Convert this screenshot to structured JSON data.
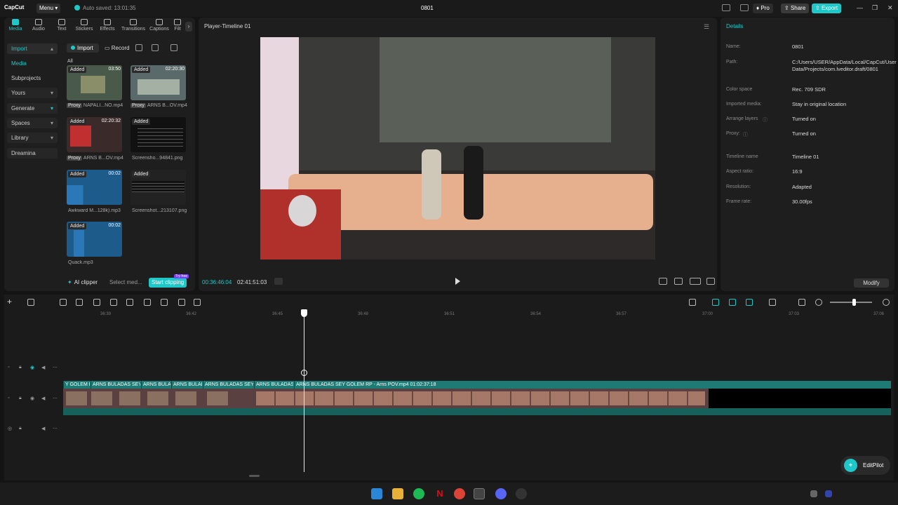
{
  "app": {
    "logo": "CapCut",
    "menu_label": "Menu",
    "autosave": "Auto saved: 13:01:35",
    "project_title": "0801",
    "pro_label": "Pro",
    "share_label": "Share",
    "export_label": "Export"
  },
  "media_tabs": [
    {
      "label": "Media"
    },
    {
      "label": "Audio"
    },
    {
      "label": "Text"
    },
    {
      "label": "Stickers"
    },
    {
      "label": "Effects"
    },
    {
      "label": "Transitions"
    },
    {
      "label": "Captions"
    },
    {
      "label": "Filt"
    }
  ],
  "sidebar": {
    "items": [
      {
        "label": "Import"
      },
      {
        "label": "Media"
      },
      {
        "label": "Subprojects"
      },
      {
        "label": "Yours"
      },
      {
        "label": "Generate"
      },
      {
        "label": "Spaces"
      },
      {
        "label": "Library"
      },
      {
        "label": "Dreamina"
      }
    ]
  },
  "media_toolbar": {
    "import_label": "Import",
    "record_label": "Record",
    "all_label": "All"
  },
  "media_items": [
    {
      "added": "Added",
      "duration": "03:50",
      "proxy": "Proxy",
      "name": "NAPALI...NO.mp4"
    },
    {
      "added": "Added",
      "duration": "02:20:30",
      "proxy": "Proxy",
      "name": "ARNS B...OV.mp4"
    },
    {
      "added": "Added",
      "duration": "02:20:32",
      "proxy": "Proxy",
      "name": "ARNS B...OV.mp4"
    },
    {
      "added": "Added",
      "duration": "",
      "proxy": "",
      "name": "Screensho...94841.png"
    },
    {
      "added": "Added",
      "duration": "00:02",
      "proxy": "",
      "name": "Awkward M...128k).mp3"
    },
    {
      "added": "Added",
      "duration": "",
      "proxy": "",
      "name": "Screenshot...213107.png"
    },
    {
      "added": "Added",
      "duration": "00:02",
      "proxy": "",
      "name": "Quack.mp3"
    }
  ],
  "ai_clipper": {
    "label": "AI clipper",
    "select": "Select med...",
    "start": "Start clipping",
    "badge": "Try free"
  },
  "player": {
    "title": "Player-Timeline 01",
    "current_time": "00:36:46:04",
    "total_time": "02:41:51:03"
  },
  "details": {
    "title": "Details",
    "rows": [
      {
        "label": "Name:",
        "value": "0801"
      },
      {
        "label": "Path:",
        "value": "C:/Users/USER/AppData/Local/CapCut/User Data/Projects/com.lveditor.draft/0801"
      },
      {
        "label": "Color space",
        "value": "Rec. 709 SDR"
      },
      {
        "label": "Imported media:",
        "value": "Stay in original location"
      },
      {
        "label": "Arrange layers",
        "value": "Turned on"
      },
      {
        "label": "Proxy:",
        "value": "Turned on"
      },
      {
        "label": "Timeline name",
        "value": "Timeline 01"
      },
      {
        "label": "Aspect ratio:",
        "value": "16:9"
      },
      {
        "label": "Resolution:",
        "value": "Adapted"
      },
      {
        "label": "Frame rate:",
        "value": "30.00fps"
      }
    ],
    "modify_label": "Modify"
  },
  "ruler": [
    "36:39",
    "36:42",
    "36:45",
    "36:48",
    "36:51",
    "36:54",
    "36:57",
    "37:00",
    "37:03",
    "37:06"
  ],
  "clips": [
    {
      "label": "Y GOLEM R"
    },
    {
      "label": "ARNS BULADAS SEY G"
    },
    {
      "label": "ARNS BULA"
    },
    {
      "label": "ARNS BULAD"
    },
    {
      "label": "ARNS BULADAS SEY G"
    },
    {
      "label": "ARNS BULADAS S"
    },
    {
      "label": "ARNS BULADAS SEY GOLEM RP - Arns POV.mp4   01:02:37:18"
    }
  ],
  "editpilot": {
    "label": "EditPilot"
  },
  "colors": {
    "accent": "#1fc8c8",
    "clip": "#1d7a75",
    "bg": "#141414"
  }
}
